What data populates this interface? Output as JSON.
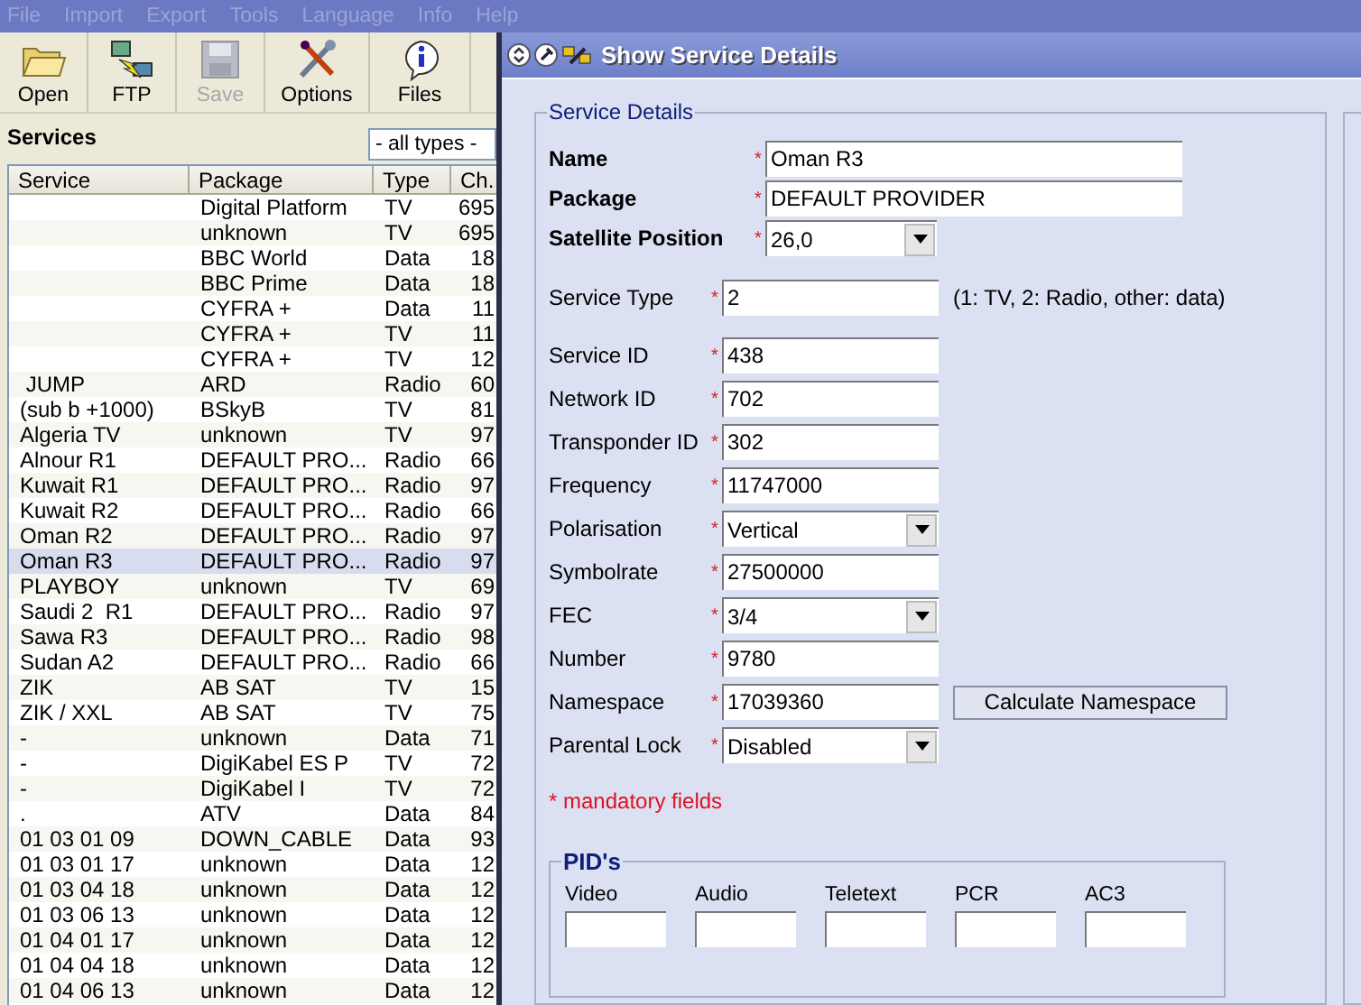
{
  "menu": [
    {
      "label": "File",
      "disabled": true
    },
    {
      "label": "Import",
      "disabled": true
    },
    {
      "label": "Export",
      "disabled": true
    },
    {
      "label": "Tools",
      "disabled": true
    },
    {
      "label": "Language",
      "disabled": true
    },
    {
      "label": "Info",
      "disabled": true
    },
    {
      "label": "Help",
      "disabled": true
    }
  ],
  "toolbar": [
    {
      "label": "Open",
      "kind": "folder",
      "disabled": false
    },
    {
      "label": "FTP",
      "kind": "ftp",
      "disabled": false
    },
    {
      "label": "Save",
      "kind": "disk",
      "disabled": true
    },
    {
      "label": "Options",
      "kind": "tools",
      "disabled": false
    },
    {
      "label": "Files",
      "kind": "info",
      "disabled": false
    }
  ],
  "services": {
    "title": "Services",
    "filter": "- all types -",
    "columns": [
      "Service",
      "Package",
      "Type",
      "Ch."
    ],
    "rows": [
      {
        "cells": [
          "",
          "Digital Platform",
          "TV",
          "695"
        ],
        "selected": false
      },
      {
        "cells": [
          "",
          "unknown",
          "TV",
          "695"
        ],
        "selected": false
      },
      {
        "cells": [
          "",
          "BBC World",
          "Data",
          "18"
        ],
        "selected": false
      },
      {
        "cells": [
          "",
          "BBC Prime",
          "Data",
          "18"
        ],
        "selected": false
      },
      {
        "cells": [
          "",
          "CYFRA +",
          "Data",
          "11"
        ],
        "selected": false
      },
      {
        "cells": [
          "",
          "CYFRA +",
          "TV",
          "11"
        ],
        "selected": false
      },
      {
        "cells": [
          "",
          "CYFRA +",
          "TV",
          "12"
        ],
        "selected": false
      },
      {
        "cells": [
          " JUMP",
          "ARD",
          "Radio",
          "60"
        ],
        "selected": false
      },
      {
        "cells": [
          "(sub b +1000)",
          "BSkyB",
          "TV",
          "81"
        ],
        "selected": false
      },
      {
        "cells": [
          "Algeria TV",
          "unknown",
          "TV",
          "97"
        ],
        "selected": false
      },
      {
        "cells": [
          "Alnour R1",
          "DEFAULT PRO...",
          "Radio",
          "66"
        ],
        "selected": false
      },
      {
        "cells": [
          "Kuwait R1",
          "DEFAULT PRO...",
          "Radio",
          "97"
        ],
        "selected": false
      },
      {
        "cells": [
          "Kuwait R2",
          "DEFAULT PRO...",
          "Radio",
          "66"
        ],
        "selected": false
      },
      {
        "cells": [
          "Oman R2",
          "DEFAULT PRO...",
          "Radio",
          "97"
        ],
        "selected": false
      },
      {
        "cells": [
          "Oman R3",
          "DEFAULT PRO...",
          "Radio",
          "97"
        ],
        "selected": true
      },
      {
        "cells": [
          "PLAYBOY",
          "unknown",
          "TV",
          "69"
        ],
        "selected": false
      },
      {
        "cells": [
          "Saudi 2  R1",
          "DEFAULT PRO...",
          "Radio",
          "97"
        ],
        "selected": false
      },
      {
        "cells": [
          "Sawa R3",
          "DEFAULT PRO...",
          "Radio",
          "98"
        ],
        "selected": false
      },
      {
        "cells": [
          "Sudan A2",
          "DEFAULT PRO...",
          "Radio",
          "66"
        ],
        "selected": false
      },
      {
        "cells": [
          "ZIK",
          "AB SAT",
          "TV",
          "15"
        ],
        "selected": false
      },
      {
        "cells": [
          "ZIK / XXL",
          "AB SAT",
          "TV",
          "75"
        ],
        "selected": false
      },
      {
        "cells": [
          "-",
          "unknown",
          "Data",
          "71"
        ],
        "selected": false
      },
      {
        "cells": [
          "-",
          "DigiKabel ES P",
          "TV",
          "72"
        ],
        "selected": false
      },
      {
        "cells": [
          "-",
          "DigiKabel I",
          "TV",
          "72"
        ],
        "selected": false
      },
      {
        "cells": [
          ".",
          "ATV",
          "Data",
          "84"
        ],
        "selected": false
      },
      {
        "cells": [
          "01 03 01 09",
          "DOWN_CABLE",
          "Data",
          "93"
        ],
        "selected": false
      },
      {
        "cells": [
          "01 03 01 17",
          "unknown",
          "Data",
          "12"
        ],
        "selected": false
      },
      {
        "cells": [
          "01 03 04 18",
          "unknown",
          "Data",
          "12"
        ],
        "selected": false
      },
      {
        "cells": [
          "01 03 06 13",
          "unknown",
          "Data",
          "12"
        ],
        "selected": false
      },
      {
        "cells": [
          "01 04 01 17",
          "unknown",
          "Data",
          "12"
        ],
        "selected": false
      },
      {
        "cells": [
          "01 04 04 18",
          "unknown",
          "Data",
          "12"
        ],
        "selected": false
      },
      {
        "cells": [
          "01 04 06 13",
          "unknown",
          "Data",
          "12"
        ],
        "selected": false
      }
    ]
  },
  "dialog": {
    "title": "Show Service Details",
    "group": "Service Details",
    "main_fields": [
      {
        "label": "Name",
        "mark": "*",
        "kind": "text",
        "value": "Oman R3"
      },
      {
        "label": "Package",
        "mark": "*",
        "kind": "text",
        "value": "DEFAULT PROVIDER"
      },
      {
        "label": "Satellite Position",
        "mark": "*",
        "kind": "select",
        "value": "26,0"
      }
    ],
    "fields": [
      {
        "label": "Service Type",
        "mark": "*",
        "kind": "text",
        "value": "2",
        "hint": "(1: TV, 2: Radio, other: data)"
      },
      {
        "label": "Service ID",
        "mark": "*",
        "kind": "text",
        "value": "438"
      },
      {
        "label": "Network ID",
        "mark": "*",
        "kind": "text",
        "value": "702"
      },
      {
        "label": "Transponder ID",
        "mark": "*",
        "kind": "text",
        "value": "302"
      },
      {
        "label": "Frequency",
        "mark": "*",
        "kind": "text",
        "value": "11747000"
      },
      {
        "label": "Polarisation",
        "mark": "*",
        "kind": "select",
        "value": "Vertical"
      },
      {
        "label": "Symbolrate",
        "mark": "*",
        "kind": "text",
        "value": "27500000"
      },
      {
        "label": "FEC",
        "mark": "*",
        "kind": "select",
        "value": "3/4"
      },
      {
        "label": "Number",
        "mark": "*",
        "kind": "text",
        "value": "9780"
      },
      {
        "label": "Namespace",
        "mark": "*",
        "kind": "text",
        "value": "17039360",
        "button": "Calculate Namespace"
      },
      {
        "label": "Parental Lock",
        "mark": "*",
        "kind": "select",
        "value": "Disabled"
      }
    ],
    "note": "* mandatory fields",
    "pids": {
      "title": "PID's",
      "fields": [
        {
          "label": "Video"
        },
        {
          "label": "Audio"
        },
        {
          "label": "Teletext"
        },
        {
          "label": "PCR"
        },
        {
          "label": "AC3"
        }
      ]
    }
  }
}
